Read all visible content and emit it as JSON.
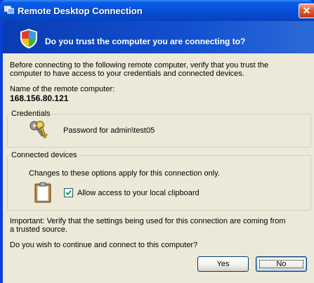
{
  "window": {
    "title": "Remote Desktop Connection",
    "close_glyph": "✕"
  },
  "banner": {
    "heading": "Do you trust the computer you are connecting to?",
    "icon": "security-shield-icon"
  },
  "intro": {
    "line1": "Before connecting to the following remote computer, verify that you trust the",
    "line2": "computer to have access to your credentials and connected devices."
  },
  "remote": {
    "label": "Name of the remote computer:",
    "value": "168.156.80.121"
  },
  "credentials": {
    "legend": "Credentials",
    "text": "Password for admin\\test05",
    "icon": "keys-icon"
  },
  "devices": {
    "legend": "Connected devices",
    "note": "Changes to these options apply for this connection only.",
    "clipboard_label": "Allow access to your local clipboard",
    "clipboard_checked": true,
    "icon": "clipboard-icon"
  },
  "important": {
    "line1": "Important: Verify that the settings being used for this connection are coming from",
    "line2": "a trusted source."
  },
  "question": "Do you wish to continue and connect to this computer?",
  "buttons": {
    "yes": "Yes",
    "no": "No"
  }
}
